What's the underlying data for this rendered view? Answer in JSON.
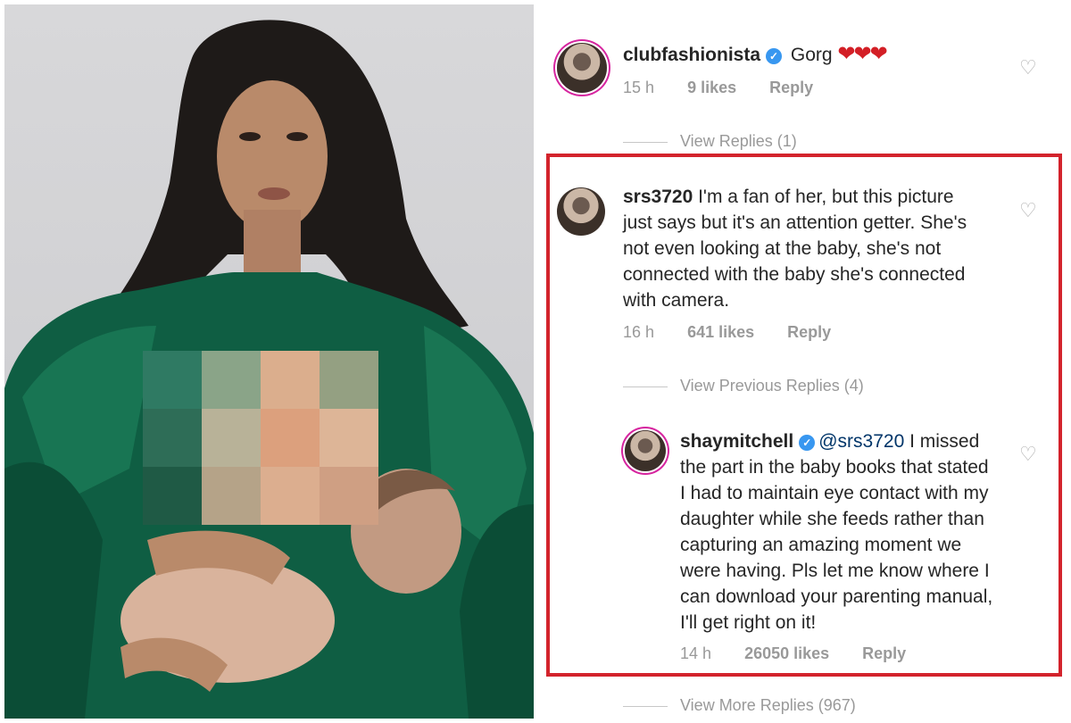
{
  "colors": {
    "highlight": "#d3232c",
    "verified": "#3897f0",
    "muted": "#999999",
    "text": "#262626"
  },
  "comments": [
    {
      "username": "clubfashionista",
      "verified": true,
      "text": "Gorg",
      "emoji": "❤❤❤",
      "age": "15 h",
      "likes": "9 likes",
      "reply": "Reply",
      "replies_link": "View Replies (1)"
    },
    {
      "username": "srs3720",
      "verified": false,
      "text_lines": [
        "I'm a fan of her, but this picture",
        "just says but it's an attention getter. She's",
        "not even looking at the baby, she's not",
        "connected with the baby she's connected",
        "with camera."
      ],
      "age": "16 h",
      "likes": "641 likes",
      "reply": "Reply",
      "replies_link": "View Previous Replies (4)"
    },
    {
      "username": "shaymitchell",
      "verified": true,
      "mention": "@srs3720",
      "text_lines": [
        "I missed",
        "the part in the baby books that stated",
        "I had to maintain eye contact with my",
        "daughter while she feeds rather than",
        "capturing an amazing moment we",
        "were having. Pls let me know where I",
        "can download your parenting manual,",
        "I'll get right on it!"
      ],
      "age": "14 h",
      "likes": "26050 likes",
      "reply": "Reply",
      "replies_link": "View More Replies (967)"
    }
  ],
  "icons": {
    "verified": "verified-badge-icon",
    "like": "heart-outline-icon"
  }
}
